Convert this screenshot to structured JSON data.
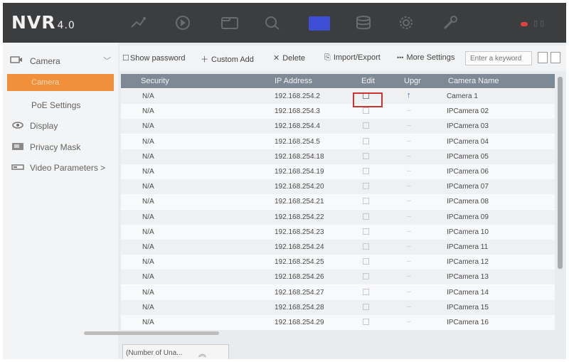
{
  "app": {
    "logo": "NVR",
    "version": "4.0"
  },
  "topnav": {
    "icons": [
      "live-view-icon",
      "playback-icon",
      "file-icon",
      "search-icon",
      "configuration-icon",
      "storage-icon",
      "settings-icon",
      "maintenance-icon"
    ],
    "active_index": 4
  },
  "sidebar": {
    "section_label": "Camera",
    "items": [
      {
        "label": "Camera",
        "active": true
      },
      {
        "label": "PoE Settings"
      },
      {
        "label": "Display"
      },
      {
        "label": "Privacy Mask"
      },
      {
        "label": "Video Parameters >"
      }
    ]
  },
  "toolbar": {
    "show_password": "Show password",
    "custom_add": "Custom Add",
    "delete": "Delete",
    "import_export": "Import/Export",
    "more_settings": "More Settings",
    "search_placeholder": "Enter a keyword"
  },
  "table": {
    "headers": [
      "Security",
      "IP Address",
      "Edit",
      "Upgr",
      "Camera Name"
    ],
    "rows": [
      {
        "security": "N/A",
        "ip": "192.168.254.2",
        "name": "Camera 1",
        "upgrade": true
      },
      {
        "security": "N/A",
        "ip": "192.168.254.3",
        "name": "IPCamera 02"
      },
      {
        "security": "N/A",
        "ip": "192.168.254.4",
        "name": "IPCamera 03"
      },
      {
        "security": "N/A",
        "ip": "192.168.254.5",
        "name": "IPCamera 04"
      },
      {
        "security": "N/A",
        "ip": "192.168.254.18",
        "name": "IPCamera 05"
      },
      {
        "security": "N/A",
        "ip": "192.168.254.19",
        "name": "IPCamera 06"
      },
      {
        "security": "N/A",
        "ip": "192.168.254.20",
        "name": "IPCamera 07"
      },
      {
        "security": "N/A",
        "ip": "192.168.254.21",
        "name": "IPCamera 08"
      },
      {
        "security": "N/A",
        "ip": "192.168.254.22",
        "name": "IPCamera 09"
      },
      {
        "security": "N/A",
        "ip": "192.168.254.23",
        "name": "IPCamera 10"
      },
      {
        "security": "N/A",
        "ip": "192.168.254.24",
        "name": "IPCamera 11"
      },
      {
        "security": "N/A",
        "ip": "192.168.254.25",
        "name": "IPCamera 12"
      },
      {
        "security": "N/A",
        "ip": "192.168.254.26",
        "name": "IPCamera 13"
      },
      {
        "security": "N/A",
        "ip": "192.168.254.27",
        "name": "IPCamera 14"
      },
      {
        "security": "N/A",
        "ip": "192.168.254.28",
        "name": "IPCamera 15"
      },
      {
        "security": "N/A",
        "ip": "192.168.254.29",
        "name": "IPCamera 16"
      }
    ]
  },
  "bottom_tab": {
    "label": "(Number of Una..."
  },
  "colors": {
    "topbar": "#3c3d3f",
    "accent": "#f28f3b",
    "nav_active": "#3e4fd6",
    "table_header": "#7d8994",
    "highlight": "#cc3333"
  }
}
